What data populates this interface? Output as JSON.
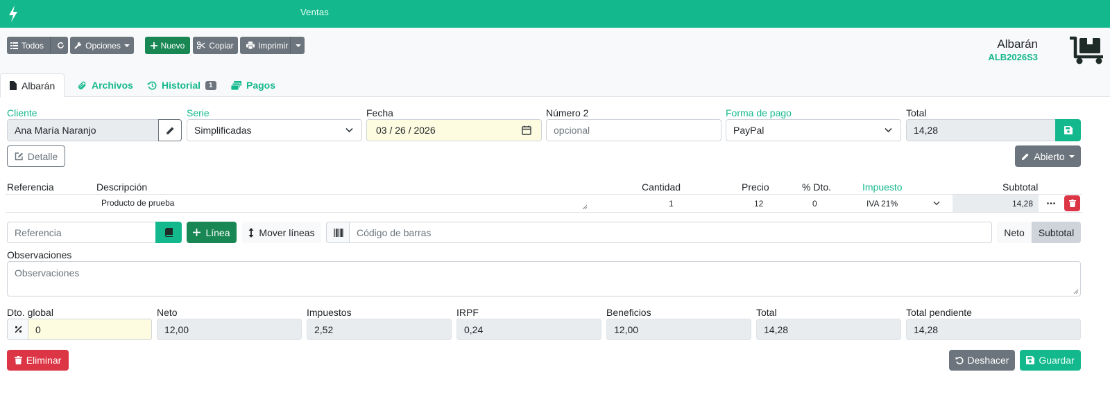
{
  "header": {
    "app_title": "Ventas"
  },
  "toolbar": {
    "all_label": "Todos",
    "options_label": "Opciones",
    "new_label": "Nuevo",
    "copy_label": "Copiar",
    "print_label": "Imprimir"
  },
  "document": {
    "type": "Albarán",
    "code": "ALB2026S3"
  },
  "tabs": [
    {
      "label": "Albarán"
    },
    {
      "label": "Archivos"
    },
    {
      "label": "Historial",
      "badge": "1"
    },
    {
      "label": "Pagos"
    }
  ],
  "form": {
    "client_label": "Cliente",
    "client_value": "Ana María Naranjo",
    "series_label": "Serie",
    "series_value": "Simplificadas",
    "date_label": "Fecha",
    "date_value": "03 / 26 / 2026",
    "number2_label": "Número 2",
    "number2_placeholder": "opcional",
    "payment_label": "Forma de pago",
    "payment_value": "PayPal",
    "total_label": "Total",
    "total_value": "14,28",
    "detail_label": "Detalle",
    "status_label": "Abierto"
  },
  "lines": {
    "headers": {
      "reference": "Referencia",
      "description": "Descripción",
      "quantity": "Cantidad",
      "price": "Precio",
      "discount": "% Dto.",
      "tax": "Impuesto",
      "subtotal": "Subtotal"
    },
    "rows": [
      {
        "reference": "",
        "description": "Producto de prueba",
        "quantity": "1",
        "price": "12",
        "discount": "0",
        "tax": "IVA 21%",
        "subtotal": "14,28"
      }
    ]
  },
  "add_line": {
    "reference_placeholder": "Referencia",
    "add_line_label": "Línea",
    "move_lines_label": "Mover líneas",
    "barcode_placeholder": "Código de barras",
    "net_label": "Neto",
    "subtotal_label": "Subtotal"
  },
  "observations": {
    "label": "Observaciones",
    "placeholder": "Observaciones"
  },
  "totals": {
    "global_discount_label": "Dto. global",
    "global_discount_value": "0",
    "net_label": "Neto",
    "net_value": "12,00",
    "taxes_label": "Impuestos",
    "taxes_value": "2,52",
    "irpf_label": "IRPF",
    "irpf_value": "0,24",
    "profit_label": "Beneficios",
    "profit_value": "12,00",
    "total_label": "Total",
    "total_value": "14,28",
    "pending_label": "Total pendiente",
    "pending_value": "14,28"
  },
  "footer": {
    "delete_label": "Eliminar",
    "undo_label": "Deshacer",
    "save_label": "Guardar"
  },
  "colors": {
    "brand": "#14b88d",
    "danger": "#dc3545",
    "secondary": "#6c757d",
    "success": "#198754"
  }
}
